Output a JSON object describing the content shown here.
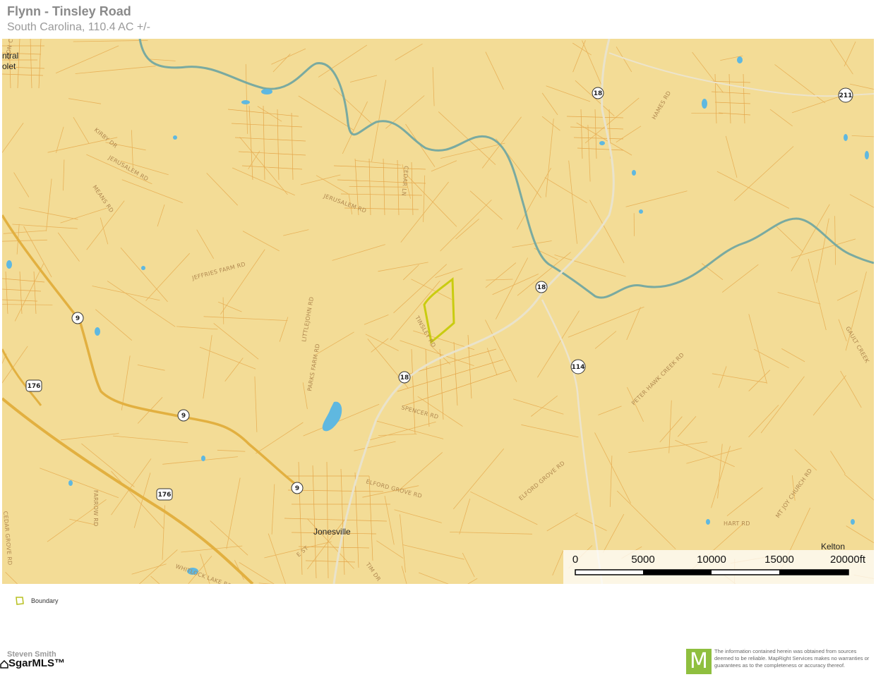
{
  "header": {
    "title": "Flynn - Tinsley Road",
    "subtitle": "South Carolina, 110.4 AC +/-"
  },
  "map": {
    "road_labels": [
      {
        "text": "ZION CHURCH RD"
      },
      {
        "text": "KIRBY DR"
      },
      {
        "text": "JERUSALEM RD"
      },
      {
        "text": "MEANS RD"
      },
      {
        "text": "JERUSALEM RD"
      },
      {
        "text": "CEDAR LN"
      },
      {
        "text": "JEFFRIES FARM RD"
      },
      {
        "text": "LITTLEJOHN RD"
      },
      {
        "text": "PARKS FARM RD"
      },
      {
        "text": "TINSLEY RD"
      },
      {
        "text": "SPENCER RD"
      },
      {
        "text": "ELFORD GROVE RD"
      },
      {
        "text": "ELFORD GROVE RD"
      },
      {
        "text": "PETER HAWK CREEK RD"
      },
      {
        "text": "HAMES RD"
      },
      {
        "text": "GAULT CREEK"
      },
      {
        "text": "FARROW RD"
      },
      {
        "text": "CEDAR GROVE RD"
      },
      {
        "text": "WHITLOCK LAKE RD"
      },
      {
        "text": "MT JOY CHURCH RD"
      },
      {
        "text": "HART RD"
      },
      {
        "text": "TIM DR"
      },
      {
        "text": "E ST"
      }
    ],
    "towns": [
      "Jonesville",
      "Kelton",
      "ntral",
      "olet"
    ],
    "shields": [
      "18",
      "18",
      "18",
      "211",
      "9",
      "9",
      "9",
      "114",
      "176",
      "176"
    ]
  },
  "scale": {
    "ticks": [
      "0",
      "5000",
      "10000",
      "15000",
      "20000ft"
    ]
  },
  "legend": {
    "boundary_label": "Boundary"
  },
  "footer": {
    "agent_name": "Steven Smith",
    "mls_text": "SgarMLS™",
    "logo_letter": "M",
    "disclaimer": "The information contained herein was obtained from sources deemed to be reliable. MapRight Services makes no warranties or guarantees as to the completeness or accuracy thereof."
  },
  "colors": {
    "map_bg": "#f3dc96",
    "parcel_line": "#e8b25a",
    "river": "#7aaaa0",
    "water": "#5fb8e0",
    "highway": "#e2b040",
    "boundary": "#c9cc10"
  }
}
